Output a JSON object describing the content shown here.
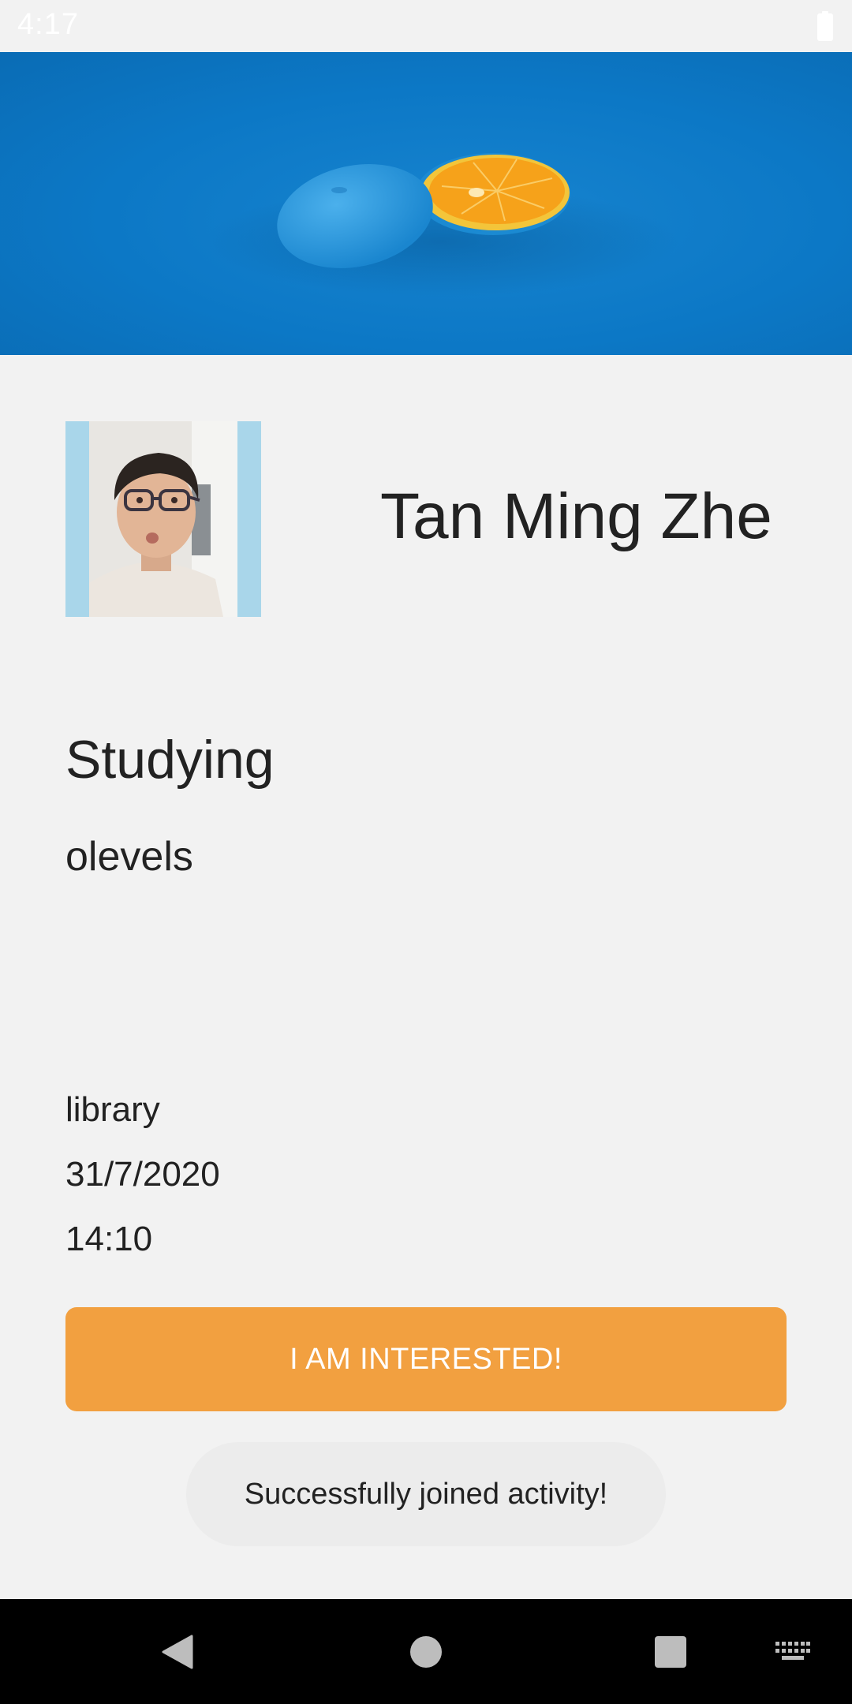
{
  "status_bar": {
    "time": "4:17",
    "battery_icon": "battery-full-icon"
  },
  "banner": {
    "image": "orange-slice-on-blue-banner",
    "background_color": "#0c78c6"
  },
  "profile": {
    "avatar": "user-avatar-photo",
    "name": "Tan Ming Zhe"
  },
  "activity": {
    "type": "Studying",
    "topic": "olevels",
    "location": "library",
    "date": "31/7/2020",
    "time": "14:10"
  },
  "actions": {
    "interest_label": "I AM INTERESTED!",
    "button_color": "#f2a040"
  },
  "toast": {
    "message": "Successfully joined activity!"
  },
  "nav_bar": {
    "back_icon": "back-triangle-icon",
    "home_icon": "home-circle-icon",
    "recents_icon": "recents-square-icon",
    "keyboard_icon": "keyboard-icon"
  }
}
